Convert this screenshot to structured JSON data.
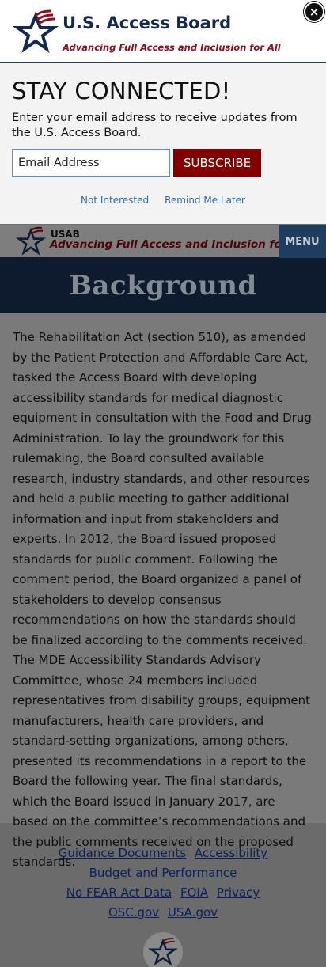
{
  "modal": {
    "logo": {
      "title": "U.S. Access Board",
      "tagline": "Advancing Full Access and Inclusion for All"
    },
    "close_label": "×",
    "heading": "STAY CONNECTED!",
    "text": "Enter your email address to receive updates from the U.S. Access Board.",
    "email_placeholder": "Email Address",
    "subscribe_label": "SUBSCRIBE",
    "not_interested_label": "Not Interested",
    "remind_later_label": "Remind Me Later"
  },
  "site_nav": {
    "abbr": "USAB",
    "tagline": "Advancing Full Access and Inclusion for All",
    "menu_label": "MENU"
  },
  "hero": {
    "title": "Background"
  },
  "content": {
    "paragraph": "The Rehabilitation Act (section 510), as amended by the Patient Protection and Affordable Care Act, tasked the Access Board with developing accessibility standards for medical diagnostic equipment in consultation with the Food and Drug Administration. To lay the groundwork for this rulemaking, the Board consulted available research, industry standards, and other resources and held a public meeting to gather additional information and input from stakeholders and experts. In 2012, the Board issued proposed standards for public comment. Following the comment period, the Board organized a panel of stakeholders to develop consensus recommendations on how the standards should be finalized according to the comments received. The MDE Accessibility Standards Advisory Committee, whose 24 members included representatives from disability groups, equipment manufacturers, health care providers, and standard-setting organizations, among others, presented its recommendations in a report to the Board the following year. The final standards, which the Board issued in January 2017, are based on the committee’s recommendations and the public comments received on the proposed standards."
  },
  "footer": {
    "links": [
      "Guidance Documents",
      "Accessibility",
      "Budget and Performance",
      "No FEAR Act Data",
      "FOIA",
      "Privacy",
      "OSC.gov",
      "USA.gov"
    ]
  },
  "colors": {
    "navy": "#15294d",
    "brand_red": "#8b1020",
    "subscribe_red": "#820000",
    "link_blue": "#2e67b1",
    "menu_blue": "#1d3e5e"
  },
  "icons": [
    "star-logo-icon",
    "close-icon",
    "footer-seal-icon"
  ]
}
